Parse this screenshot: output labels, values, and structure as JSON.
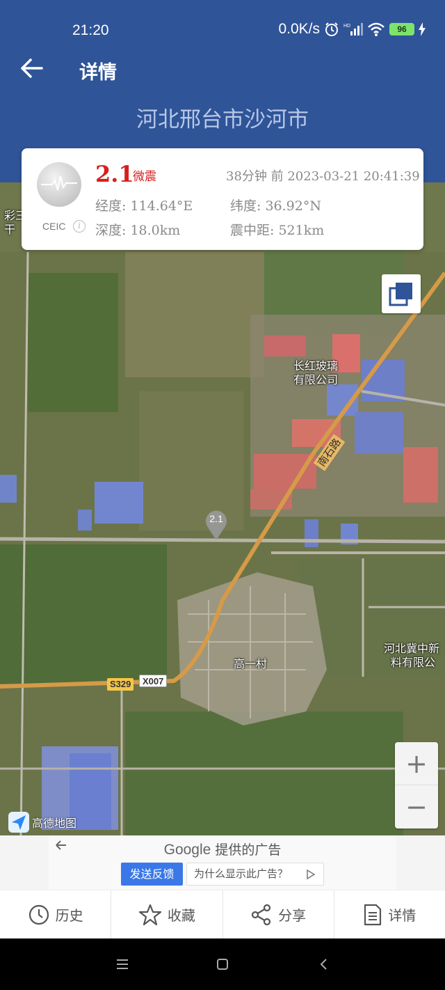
{
  "status_bar": {
    "time": "21:20",
    "net_speed": "0.0K/s",
    "hd": "HD",
    "battery": "96"
  },
  "header": {
    "title": "详情",
    "location": "河北邢台市沙河市"
  },
  "quake": {
    "source": "CEIC",
    "magnitude": "2.1",
    "level": "微震",
    "time_ago": "38分钟 前 2023-03-21 20:41:39",
    "longitude": "经度: 114.64°E",
    "latitude": "纬度: 36.92°N",
    "depth": "深度: 18.0km",
    "distance": "震中距: 521km"
  },
  "map": {
    "marker_label": "2.1",
    "labels": {
      "glass_company_line1": "长红玻璃",
      "glass_company_line2": "有限公司",
      "village": "高一村",
      "right_company_line1": "河北冀中新",
      "right_company_line2": "料有限公",
      "left_edge_line1": "彩三",
      "left_edge_line2": "干",
      "road_name": "南石路",
      "road_s329": "S329",
      "road_x007": "X007"
    },
    "provider": "高德地图",
    "zoom_in": "+",
    "zoom_out": "−"
  },
  "ad": {
    "provider_brand": "Google",
    "provider_text": "提供的广告",
    "feedback": "发送反馈",
    "why": "为什么显示此广告？"
  },
  "tabs": [
    {
      "label": "历史",
      "icon": "clock-icon"
    },
    {
      "label": "收藏",
      "icon": "star-icon"
    },
    {
      "label": "分享",
      "icon": "share-icon"
    },
    {
      "label": "详情",
      "icon": "document-icon"
    }
  ]
}
